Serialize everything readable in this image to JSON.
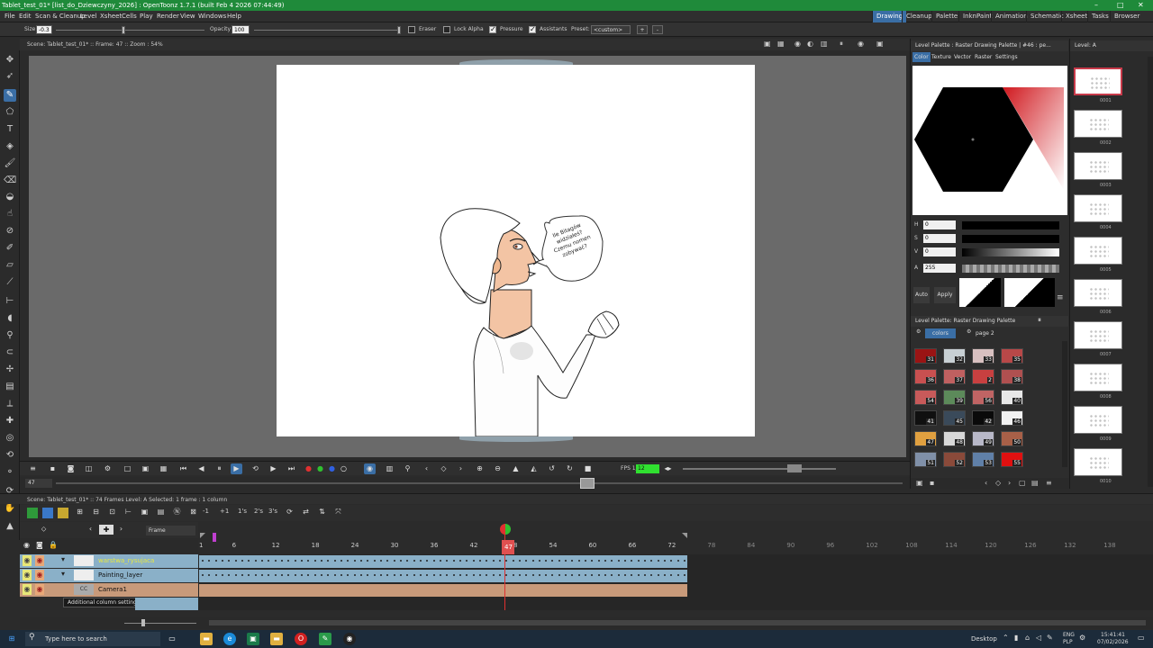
{
  "window": {
    "title": "Tablet_test_01* [list_do_Dziewczyny_2026] : OpenToonz 1.7.1 (built Feb  4 2026 07:44:49)",
    "controls": [
      "–",
      "□",
      "✕"
    ]
  },
  "menu": [
    "File",
    "Edit",
    "Scan & Cleanup",
    "Level",
    "Xsheet",
    "Cells",
    "Play",
    "Render",
    "View",
    "Windows",
    "Help"
  ],
  "rooms": [
    {
      "label": "Drawing",
      "active": true
    },
    {
      "label": "Cleanup",
      "active": false
    },
    {
      "label": "Palette",
      "active": false
    },
    {
      "label": "InknPaint",
      "active": false
    },
    {
      "label": "Animation",
      "active": false
    },
    {
      "label": "Schematic",
      "active": false
    },
    {
      "label": "Xsheet",
      "active": false
    },
    {
      "label": "Tasks",
      "active": false
    },
    {
      "label": "Browser",
      "active": false
    }
  ],
  "tool_options": {
    "size_label": "Size",
    "size_value": "-0.3",
    "opacity_label": "Opacity",
    "opacity_value": "100",
    "eraser_label": "Eraser",
    "lock_alpha_label": "Lock Alpha",
    "pressure_label": "Pressure",
    "assistants_label": "Assistants",
    "preset_label": "Preset:",
    "preset_value": "<custom>",
    "add_label": "+",
    "remove_label": "-"
  },
  "viewer": {
    "info": "Scene: Tablet_test_01*  ::  Frame: 47  ::  Zoom : 54%",
    "speech_text": [
      "Ile",
      "Bitagów",
      "widziałeś?",
      "Czemu",
      "nomen",
      "zobywać?"
    ],
    "frame_field": "47",
    "fps_label": "FPS 1/",
    "fps_value": "12"
  },
  "palette": {
    "title": "Level Palette : Raster Drawing Palette | #46 : pe...",
    "tabs": [
      "Color",
      "Texture",
      "Vector",
      "Raster",
      "Settings"
    ],
    "active_tab": "Color",
    "hsv": [
      {
        "label": "H",
        "value": "0"
      },
      {
        "label": "S",
        "value": "0"
      },
      {
        "label": "V",
        "value": "0"
      },
      {
        "label": "A",
        "value": "255"
      }
    ],
    "auto_label": "Auto",
    "apply_label": "Apply",
    "current_color": "#000000",
    "wheel_accent": "#d0181e",
    "styles_title": "Level Palette: Raster Drawing Palette",
    "pages": [
      "colors",
      "page 2"
    ],
    "chips": [
      {
        "n": "31",
        "c": "#9a1414"
      },
      {
        "n": "32",
        "c": "#c8d0d4"
      },
      {
        "n": "33",
        "c": "#d8c0c0"
      },
      {
        "n": "35",
        "c": "#b84848"
      },
      {
        "n": "36",
        "c": "#c85050"
      },
      {
        "n": "37",
        "c": "#c06060"
      },
      {
        "n": "2",
        "c": "#c84040"
      },
      {
        "n": "38",
        "c": "#b05050"
      },
      {
        "n": "54",
        "c": "#c85a5a"
      },
      {
        "n": "39",
        "c": "#5c8a5a"
      },
      {
        "n": "56",
        "c": "#c06464"
      },
      {
        "n": "40",
        "c": "#e8e8e8"
      },
      {
        "n": "41",
        "c": "#101010"
      },
      {
        "n": "45",
        "c": "#3a4a5a"
      },
      {
        "n": "42",
        "c": "#0a0a0a"
      },
      {
        "n": "46",
        "c": "#f2f2f2"
      },
      {
        "n": "47",
        "c": "#e0a040"
      },
      {
        "n": "48",
        "c": "#d8d8d8"
      },
      {
        "n": "49",
        "c": "#b8b8c8"
      },
      {
        "n": "50",
        "c": "#a86048"
      },
      {
        "n": "51",
        "c": "#8090a8"
      },
      {
        "n": "52",
        "c": "#8a4a3a"
      },
      {
        "n": "53",
        "c": "#6080a8"
      },
      {
        "n": "55",
        "c": "#e01010"
      }
    ]
  },
  "level_strip": {
    "title": "Level: A",
    "frames": [
      "0001",
      "0002",
      "0003",
      "0004",
      "0005",
      "0006",
      "0007",
      "0008",
      "0009",
      "0010"
    ]
  },
  "xsheet": {
    "info": "Scene: Tablet_test_01*  ::  74 Frames  Level: A   Selected: 1 frame : 1 column",
    "frame_mode": "Frame",
    "step_labels": [
      "-1",
      "+1",
      "1's",
      "2's",
      "3's"
    ],
    "ruler_ticks": [
      "1",
      "6",
      "12",
      "18",
      "24",
      "30",
      "36",
      "42",
      "48",
      "54",
      "60",
      "66",
      "72",
      "78",
      "84",
      "90",
      "96",
      "102",
      "108",
      "114",
      "120",
      "126",
      "132",
      "138"
    ],
    "current_frame": 47,
    "total_frames": 74,
    "layers": [
      {
        "name": "warstwa_rysujaca",
        "color": "#8ab0c8",
        "name_color": "#e8e840"
      },
      {
        "name": "Painting_layer",
        "color": "#8ab0c8",
        "name_color": "#111111"
      },
      {
        "name": "Camera1",
        "color": "#c89a7a",
        "name_color": "#111111"
      }
    ],
    "tooltip": "Additional column settings"
  },
  "taskbar": {
    "search_placeholder": "Type here to search",
    "desktop_label": "Desktop",
    "lang": "ENG",
    "region": "PLP",
    "time": "15:41:41",
    "date": "07/02/2026"
  }
}
